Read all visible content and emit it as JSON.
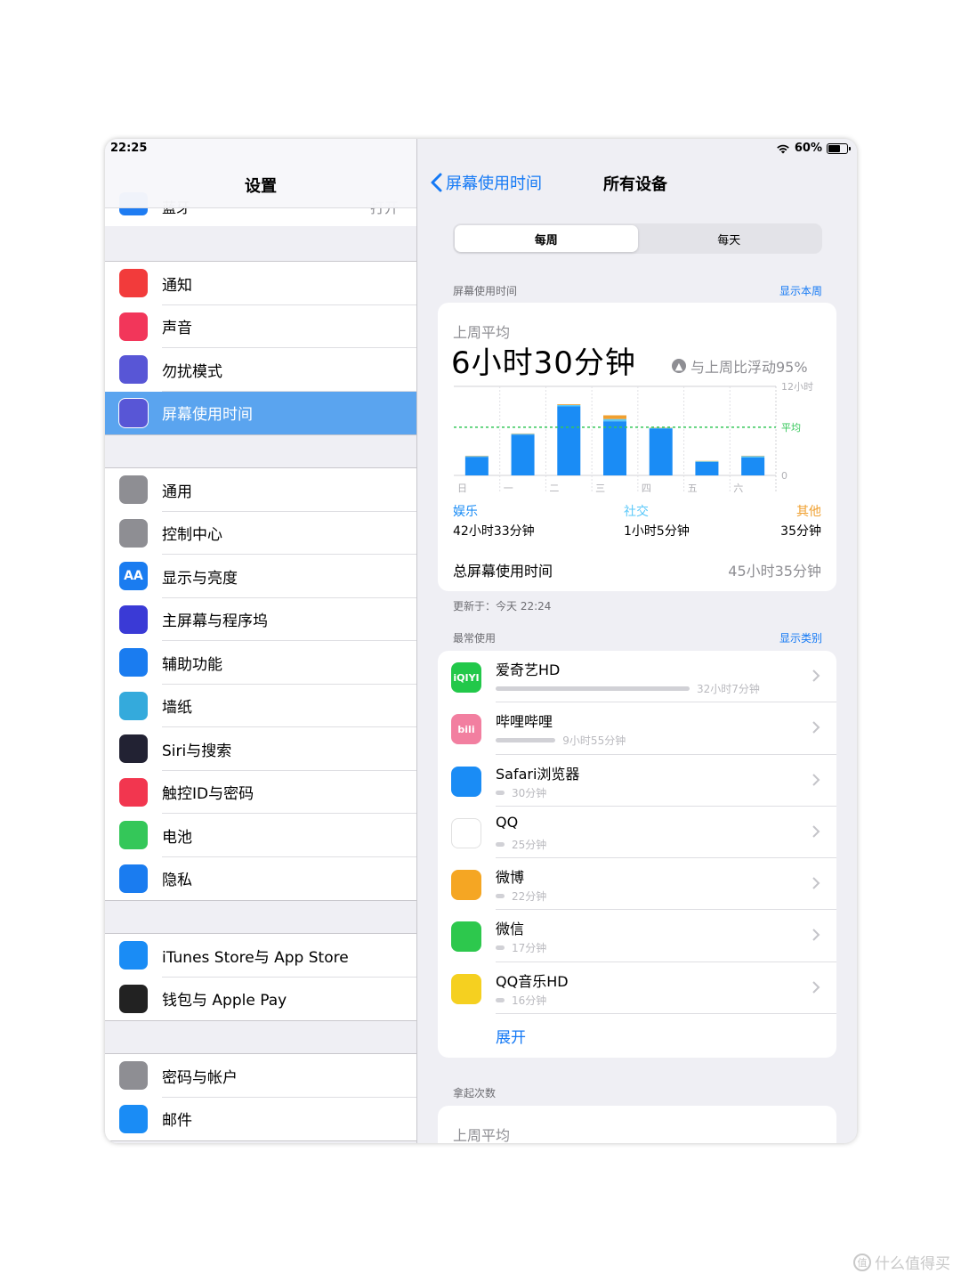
{
  "status": {
    "time": "22:25",
    "battery": "60%",
    "battery_level": 0.6
  },
  "sidebar": {
    "title": "设置",
    "peek": {
      "label": "蓝牙",
      "value": "打开"
    },
    "groups": [
      [
        {
          "label": "通知",
          "icon": "notifications-icon",
          "color": "#f23b3b"
        },
        {
          "label": "声音",
          "icon": "sound-icon",
          "color": "#f2365a"
        },
        {
          "label": "勿扰模式",
          "icon": "moon-icon",
          "color": "#5856d6"
        },
        {
          "label": "屏幕使用时间",
          "icon": "hourglass-icon",
          "color": "#5856d6",
          "selected": true
        }
      ],
      [
        {
          "label": "通用",
          "icon": "gear-icon",
          "color": "#8e8e93"
        },
        {
          "label": "控制中心",
          "icon": "toggles-icon",
          "color": "#8e8e93"
        },
        {
          "label": "显示与亮度",
          "icon": "display-icon",
          "color": "#1a7cf0",
          "glyph": "AA"
        },
        {
          "label": "主屏幕与程序坞",
          "icon": "grid-icon",
          "color": "#3a3ad6"
        },
        {
          "label": "辅助功能",
          "icon": "accessibility-icon",
          "color": "#1a7cf0"
        },
        {
          "label": "墙纸",
          "icon": "flower-icon",
          "color": "#34aadc"
        },
        {
          "label": "Siri与搜索",
          "icon": "siri-icon",
          "color": "#222233"
        },
        {
          "label": "触控ID与密码",
          "icon": "fingerprint-icon",
          "color": "#f2364f"
        },
        {
          "label": "电池",
          "icon": "battery-icon",
          "color": "#34c759"
        },
        {
          "label": "隐私",
          "icon": "hand-icon",
          "color": "#1a7cf0"
        }
      ],
      [
        {
          "label": "iTunes Store与 App Store",
          "icon": "appstore-icon",
          "color": "#1a8cf5"
        },
        {
          "label": "钱包与 Apple Pay",
          "icon": "wallet-icon",
          "color": "#222222"
        }
      ],
      [
        {
          "label": "密码与帐户",
          "icon": "key-icon",
          "color": "#8e8e93"
        },
        {
          "label": "邮件",
          "icon": "mail-icon",
          "color": "#1a8cf5"
        }
      ]
    ]
  },
  "detail": {
    "back_label": "屏幕使用时间",
    "title": "所有设备",
    "tabs": [
      {
        "label": "每周",
        "active": true
      },
      {
        "label": "每天",
        "active": false
      }
    ],
    "screen_time_header": "屏幕使用时间",
    "show_this_week": "显示本周",
    "average_label": "上周平均",
    "average_value": "6小时30分钟",
    "trend_text": "与上周比浮动95%",
    "update_text": "更新于：今天 22:24",
    "total_label": "总屏幕使用时间",
    "total_value": "45小时35分钟",
    "categories": [
      {
        "name": "娱乐",
        "value": "42小时33分钟",
        "color": "#1a8cf5"
      },
      {
        "name": "社交",
        "value": "1小时5分钟",
        "color": "#5ac8fa"
      },
      {
        "name": "其他",
        "value": "35分钟",
        "color": "#f0a030"
      }
    ],
    "most_used_header": "最常使用",
    "show_categories": "显示类别",
    "expand_label": "展开",
    "pickups_header": "拿起次数",
    "pickups_avg_label": "上周平均"
  },
  "apps": [
    {
      "name": "爱奇艺HD",
      "time": "32小时7分钟",
      "minutes": 1927,
      "icon": "iqiyi-icon",
      "color": "#22c84a",
      "glyph": "iQIYI"
    },
    {
      "name": "哔哩哔哩",
      "time": "9小时55分钟",
      "minutes": 595,
      "icon": "bilibili-icon",
      "color": "#f27fa0",
      "glyph": "bili"
    },
    {
      "name": "Safari浏览器",
      "time": "30分钟",
      "minutes": 30,
      "icon": "safari-icon",
      "color": "#1a8cf5",
      "glyph": ""
    },
    {
      "name": "QQ",
      "time": "25分钟",
      "minutes": 25,
      "icon": "qq-icon",
      "color": "#ffffff",
      "glyph": ""
    },
    {
      "name": "微博",
      "time": "22分钟",
      "minutes": 22,
      "icon": "weibo-icon",
      "color": "#f5a623",
      "glyph": ""
    },
    {
      "name": "微信",
      "time": "17分钟",
      "minutes": 17,
      "icon": "wechat-icon",
      "color": "#2dc84d",
      "glyph": ""
    },
    {
      "name": "QQ音乐HD",
      "time": "16分钟",
      "minutes": 16,
      "icon": "qqmusic-icon",
      "color": "#f5d020",
      "glyph": ""
    }
  ],
  "chart_data": {
    "type": "bar",
    "categories": [
      "日",
      "一",
      "二",
      "三",
      "四",
      "五",
      "六"
    ],
    "series": [
      {
        "name": "娱乐",
        "values": [
          2.5,
          5.5,
          9.3,
          7.3,
          6.3,
          1.8,
          2.4
        ]
      },
      {
        "name": "社交",
        "values": [
          0.1,
          0.1,
          0.2,
          0.3,
          0.1,
          0.1,
          0.2
        ]
      },
      {
        "name": "其他",
        "values": [
          0.05,
          0.05,
          0.1,
          0.5,
          0.05,
          0.05,
          0.05
        ]
      }
    ],
    "ylim": [
      0,
      12
    ],
    "ymax_label": "12小时",
    "ymin_label": "0",
    "average_value": 6.5,
    "average_label": "平均"
  },
  "watermark": {
    "text": "什么值得买",
    "glyph": "值"
  }
}
